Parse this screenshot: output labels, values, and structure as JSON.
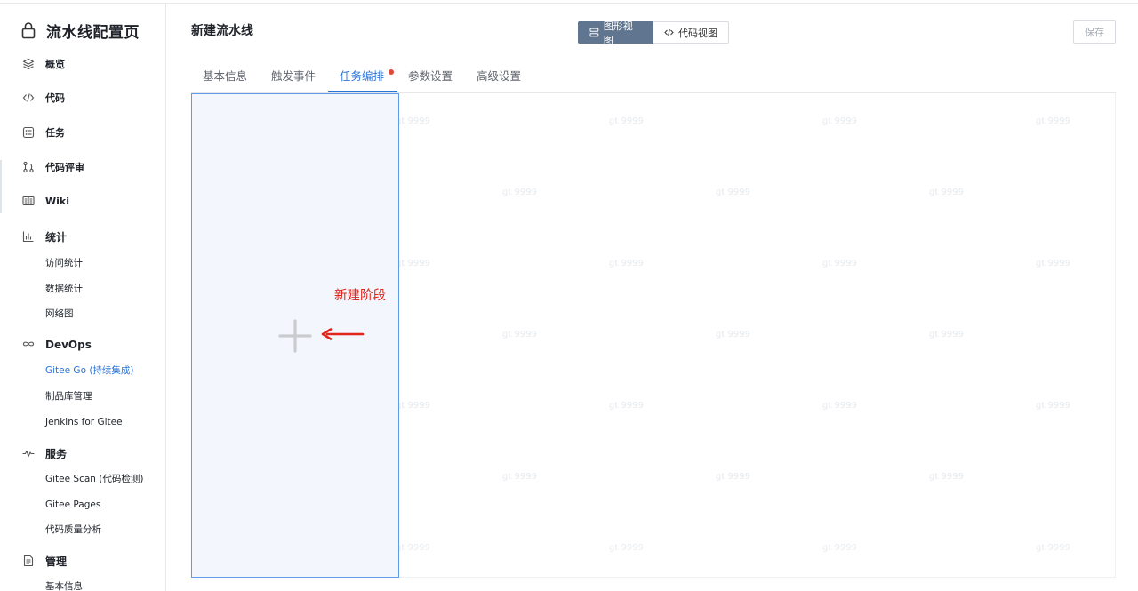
{
  "sidebar": {
    "project_title": "流水线配置页",
    "items": [
      {
        "label": "概览",
        "icon": "layers-icon"
      },
      {
        "label": "代码",
        "icon": "code-icon"
      },
      {
        "label": "任务",
        "icon": "task-icon"
      },
      {
        "label": "代码评审",
        "icon": "pull-request-icon"
      },
      {
        "label": "Wiki",
        "icon": "wiki-icon"
      }
    ],
    "groups": {
      "stats": {
        "label": "统计",
        "icon": "bar-chart-icon",
        "children": [
          "访问统计",
          "数据统计",
          "网络图"
        ]
      },
      "devops": {
        "label": "DevOps",
        "icon": "infinity-icon",
        "children": [
          "Gitee Go (持续集成)",
          "制品库管理",
          "Jenkins for Gitee"
        ]
      },
      "service": {
        "label": "服务",
        "icon": "pulse-icon",
        "children": [
          "Gitee Scan (代码检测)",
          "Gitee Pages",
          "代码质量分析"
        ]
      },
      "manage": {
        "label": "管理",
        "icon": "document-icon",
        "children": [
          "基本信息"
        ]
      }
    }
  },
  "header": {
    "title": "新建流水线",
    "view_graph_label": "图形视图",
    "view_code_label": "代码视图",
    "save_label": "保存"
  },
  "tabs": [
    {
      "label": "基本信息"
    },
    {
      "label": "触发事件"
    },
    {
      "label": "任务编排"
    },
    {
      "label": "参数设置"
    },
    {
      "label": "高级设置"
    }
  ],
  "active_tab": "任务编排",
  "canvas": {
    "watermark": "gt 9999",
    "annotation": "新建阶段"
  },
  "colors": {
    "accent": "#2d74d8",
    "toggle_active": "#5f7590",
    "annotation": "#e1251b",
    "badge_dot": "#e0483b",
    "stage_bg": "#f3f7fd"
  }
}
